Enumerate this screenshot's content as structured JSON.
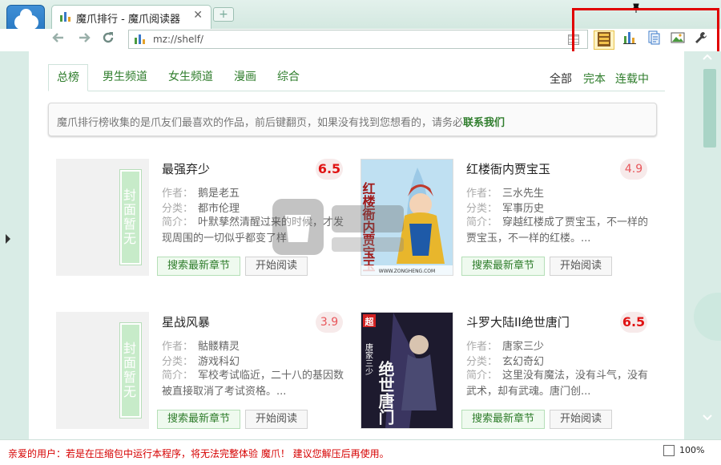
{
  "window": {
    "tab_title": "魔爪排行 - 魔爪阅读器",
    "close_glyph": "✕",
    "new_tab_glyph": "+",
    "address": "mz://shelf/"
  },
  "toolbar": {
    "tools": [
      "bookshelf-icon",
      "chart-icon",
      "document-icon",
      "image-icon",
      "wrench-icon"
    ],
    "active_tool": "bookshelf-icon"
  },
  "content": {
    "tabs": [
      "总榜",
      "男生频道",
      "女生频道",
      "漫画",
      "综合"
    ],
    "active_tab": "总榜",
    "filters": [
      "全部",
      "完本",
      "连载中"
    ],
    "notice_text": "魔爪排行榜收集的是爪友们最喜欢的作品，前后键翻页，如果没有找到您想看的，请务必",
    "notice_link": "联系我们",
    "cover_placeholder": "封面暂无",
    "labels": {
      "author": "作者：",
      "category": "分类：",
      "intro": "简介："
    },
    "search_btn": "搜索最新章节",
    "read_btn": "开始阅读"
  },
  "books": [
    {
      "title": "最强弃少",
      "score": "6.5",
      "hot": true,
      "author": "鹅是老五",
      "category": "都市伦理",
      "intro": "叶默孳然清醒过来的时候，才发现周围的一切似乎都变了样",
      "cover": "placeholder"
    },
    {
      "title": "红楼衙内贾宝玉",
      "score": "4.9",
      "hot": false,
      "author": "三水先生",
      "category": "军事历史",
      "intro": "穿越红楼成了贾宝玉，不一样的贾宝玉，不一样的红楼。...",
      "cover": "image",
      "cover_text": "红楼衙内贾宝玉",
      "cover_caption": "WWW.ZONGHENG.COM"
    },
    {
      "title": "星战风暴",
      "score": "3.9",
      "hot": false,
      "author": "骷髅精灵",
      "category": "游戏科幻",
      "intro": "军校考试临近，二十八的基因数被直接取消了考试资格。...",
      "cover": "placeholder"
    },
    {
      "title": "斗罗大陆II绝世唐门",
      "score": "6.5",
      "hot": true,
      "author": "唐家三少",
      "category": "玄幻奇幻",
      "intro": "这里没有魔法，没有斗气，没有武术，却有武魂。唐门创...",
      "cover": "image",
      "cover_text": "绝世唐门",
      "cover_author": "唐家三少",
      "cover_badge": "超"
    }
  ],
  "status": {
    "message": "亲爱的用户：若是在压缩包中运行本程序，将无法完整体验 魔爪！ 建议您解压后再使用。",
    "zoom": "100%"
  },
  "colors": {
    "accent_green": "#2f7d2c",
    "score_red": "#e01414",
    "highlight_red": "#e00000",
    "window_bg": "#d9ece6"
  }
}
